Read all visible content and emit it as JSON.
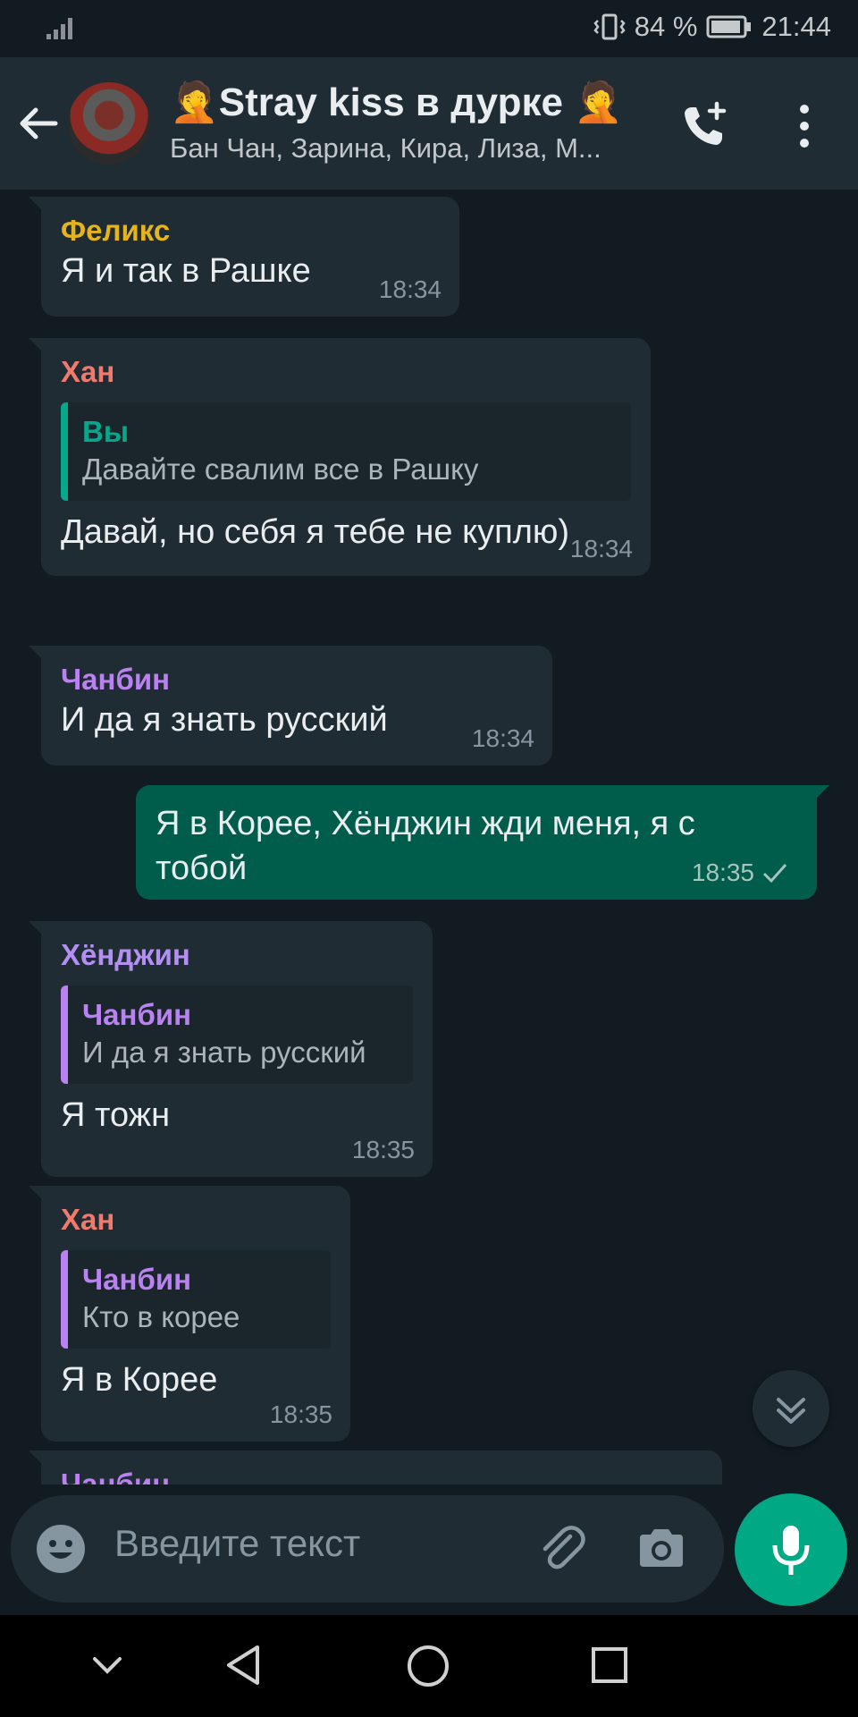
{
  "status_bar": {
    "battery": "84 %",
    "time": "21:44"
  },
  "header": {
    "title": "🤦Stray kiss в дурке 🤦",
    "subtitle": "Бан Чан, Зарина, Кира, Лиза, М..."
  },
  "colors": {
    "accent": "#00a884",
    "outgoing_bubble": "#005c4b",
    "incoming_bubble": "#202c33",
    "felix": "#e5b41d",
    "han": "#ef7a6d",
    "changbin": "#b982f0",
    "hyunjin": "#b38ff3",
    "you": "#06a88c"
  },
  "messages": [
    {
      "sender": "Феликс",
      "text": "Я и так в Рашке",
      "time": "18:34"
    },
    {
      "sender": "Хан",
      "quote_sender": "Вы",
      "quote_text": "Давайте свалим все в Рашку",
      "text": "Давай, но себя я тебе не куплю)",
      "time": "18:34"
    },
    {
      "sender": "Чанбин",
      "text": "И да я знать русский",
      "time": "18:34"
    },
    {
      "text": "Я в Корее, Хёнджин жди меня, я с тобой",
      "time": "18:35"
    },
    {
      "sender": "Хёнджин",
      "quote_sender": "Чанбин",
      "quote_text": "И да я знать русский",
      "text": "Я тожн",
      "time": "18:35"
    },
    {
      "sender": "Хан",
      "quote_sender": "Чанбин",
      "quote_text": "Кто в корее",
      "text": "Я в Корее",
      "time": "18:35"
    },
    {
      "sender": "Чанбин"
    }
  ],
  "input": {
    "placeholder": "Введите текст"
  },
  "icons": [
    "signal-icon",
    "vibrate-icon",
    "battery-icon",
    "back-arrow-icon",
    "add-call-icon",
    "more-vert-icon",
    "double-chevron-down-icon",
    "emoji-icon",
    "attach-icon",
    "camera-icon",
    "mic-icon",
    "nav-hide-icon",
    "nav-back-icon",
    "nav-home-icon",
    "nav-recents-icon"
  ]
}
